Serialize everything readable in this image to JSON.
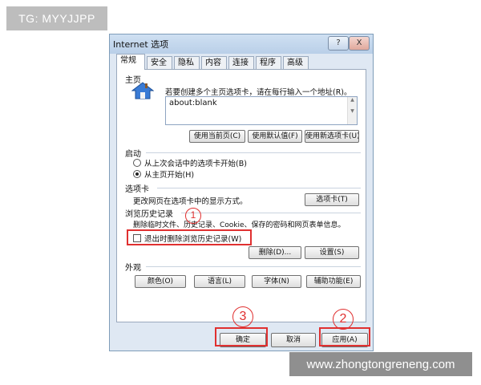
{
  "badge": "TG: MYYJJPP",
  "watermark": "www.zhongtongreneng.com",
  "window": {
    "title": "Internet 选项",
    "help_glyph": "?",
    "close_glyph": "X"
  },
  "tabs": [
    "常规",
    "安全",
    "隐私",
    "内容",
    "连接",
    "程序",
    "高级"
  ],
  "home": {
    "title": "主页",
    "hint": "若要创建多个主页选项卡，请在每行输入一个地址(R)。",
    "url": "about:blank",
    "btn_current": "使用当前页(C)",
    "btn_default": "使用默认值(F)",
    "btn_newtab": "使用新选项卡(U)"
  },
  "startup": {
    "title": "启动",
    "opt_last": "从上次会话中的选项卡开始(B)",
    "opt_home": "从主页开始(H)"
  },
  "tabsec": {
    "title": "选项卡",
    "desc": "更改网页在选项卡中的显示方式。",
    "btn": "选项卡(T)"
  },
  "history": {
    "title": "浏览历史记录",
    "desc": "删除临时文件、历史记录、Cookie、保存的密码和网页表单信息。",
    "checkbox": "退出时删除浏览历史记录(W)",
    "btn_delete": "删除(D)...",
    "btn_settings": "设置(S)"
  },
  "appearance": {
    "title": "外观",
    "btn_colors": "颜色(O)",
    "btn_lang": "语言(L)",
    "btn_fonts": "字体(N)",
    "btn_access": "辅助功能(E)"
  },
  "footer": {
    "btn_ok": "确定",
    "btn_cancel": "取消",
    "btn_apply": "应用(A)"
  },
  "annotations": {
    "m1": "1",
    "m2": "2",
    "m3": "3"
  }
}
